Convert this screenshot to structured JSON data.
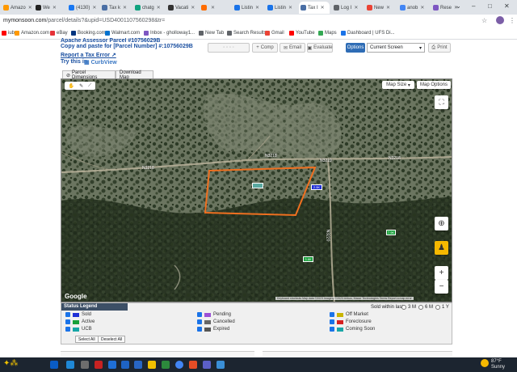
{
  "browser": {
    "tabs": [
      {
        "label": "Amazo",
        "color": "#ff9900"
      },
      {
        "label": "We",
        "color": "#222222"
      },
      {
        "label": "(4130)",
        "color": "#1877f2"
      },
      {
        "label": "Tax k",
        "color": "#4a6fa5"
      },
      {
        "label": "chatg",
        "color": "#10a37f"
      },
      {
        "label": "Vacati",
        "color": "#333333"
      },
      {
        "label": "",
        "color": "#ff6d00"
      },
      {
        "label": "Listin",
        "color": "#1a73e8"
      },
      {
        "label": "Listin",
        "color": "#1a73e8"
      },
      {
        "label": "Tax I",
        "color": "#4a6fa5"
      },
      {
        "label": "Log I",
        "color": "#5f6368"
      },
      {
        "label": "New",
        "color": "#ea4335"
      },
      {
        "label": "anob",
        "color": "#4285f4"
      },
      {
        "label": "Rese",
        "color": "#7e57c2"
      }
    ],
    "url_host": "mymonsoon.com",
    "url_path": "/parcel/details?&upid=USD4001107560298&tr=",
    "bookmarks": [
      {
        "label": "iube",
        "color": "#ff0000"
      },
      {
        "label": "Amazon.com",
        "color": "#ff9900"
      },
      {
        "label": "eBay",
        "color": "#e53238"
      },
      {
        "label": "Booking.com",
        "color": "#003580"
      },
      {
        "label": "Walmart.com",
        "color": "#0071ce"
      },
      {
        "label": "Inbox - gholloway1...",
        "color": "#7e57c2"
      },
      {
        "label": "New Tab",
        "color": "#5f6368"
      },
      {
        "label": "Search Results",
        "color": "#5f6368"
      },
      {
        "label": "Gmail",
        "color": "#ea4335"
      },
      {
        "label": "YouTube",
        "color": "#ff0000"
      },
      {
        "label": "Maps",
        "color": "#34a853"
      },
      {
        "label": "Dashboard | UFS Di...",
        "color": "#1a73e8"
      }
    ]
  },
  "parcel": {
    "title_cut": "Apache Assessor Parcel #10756029B",
    "copy_line": "Copy and paste for [Parcel Number] #:10756029B",
    "report_error": "Report a Tax Error",
    "try_this": "Try this in",
    "curbview": "CurbView"
  },
  "toolbar": {
    "comp_label": "Comp",
    "email_label": "Email",
    "evaluate_label": "Evaluate",
    "options_label": "Options",
    "screen_select": "Current Screen",
    "print_label": "Print"
  },
  "map_tabs": {
    "parcel_dimensions": "Parcel Dimensions",
    "download_map": "Download Map"
  },
  "map": {
    "map_size": "Map Size",
    "map_options": "Map Options",
    "road_n3218_left": "N3218",
    "road_n3218_right": "N3218",
    "road_n3218_top": "N3218",
    "road_n3219": "N3219",
    "road_vertical": "N3220",
    "marker_sold": "2.5K",
    "marker_green1": "7.9K",
    "marker_green2": "3.6K",
    "marker_green3": "7.5K",
    "google": "Google",
    "attribution": "Keyboard shortcuts   Map data ©2023 Imagery ©2023 Airbus, Maxar Technologies   Terms   Report a map error"
  },
  "legend": {
    "title": "Status Legend",
    "sold_within_label": "Sold within last",
    "radio_3m": "3 M",
    "radio_6m": "6 M",
    "radio_1y": "1 Y",
    "col1": [
      {
        "label": "Sold",
        "color": "#1f2fd6"
      },
      {
        "label": "Active",
        "color": "#18a03a"
      },
      {
        "label": "UCB",
        "color": "#16a6a6"
      }
    ],
    "col2": [
      {
        "label": "Pending",
        "color": "#9b4fd6"
      },
      {
        "label": "Cancelled",
        "color": "#666666"
      },
      {
        "label": "Expired",
        "color": "#555555"
      }
    ],
    "col3": [
      {
        "label": "Off Market",
        "color": "#c9b400"
      },
      {
        "label": "Foreclosure",
        "color": "#d62020"
      },
      {
        "label": "Coming Soon",
        "color": "#1aa6a6"
      }
    ],
    "select_all": "Select All",
    "deselect_all": "Deselect All"
  },
  "taskbar": {
    "temperature": "87°F",
    "weather": "Sunny"
  }
}
